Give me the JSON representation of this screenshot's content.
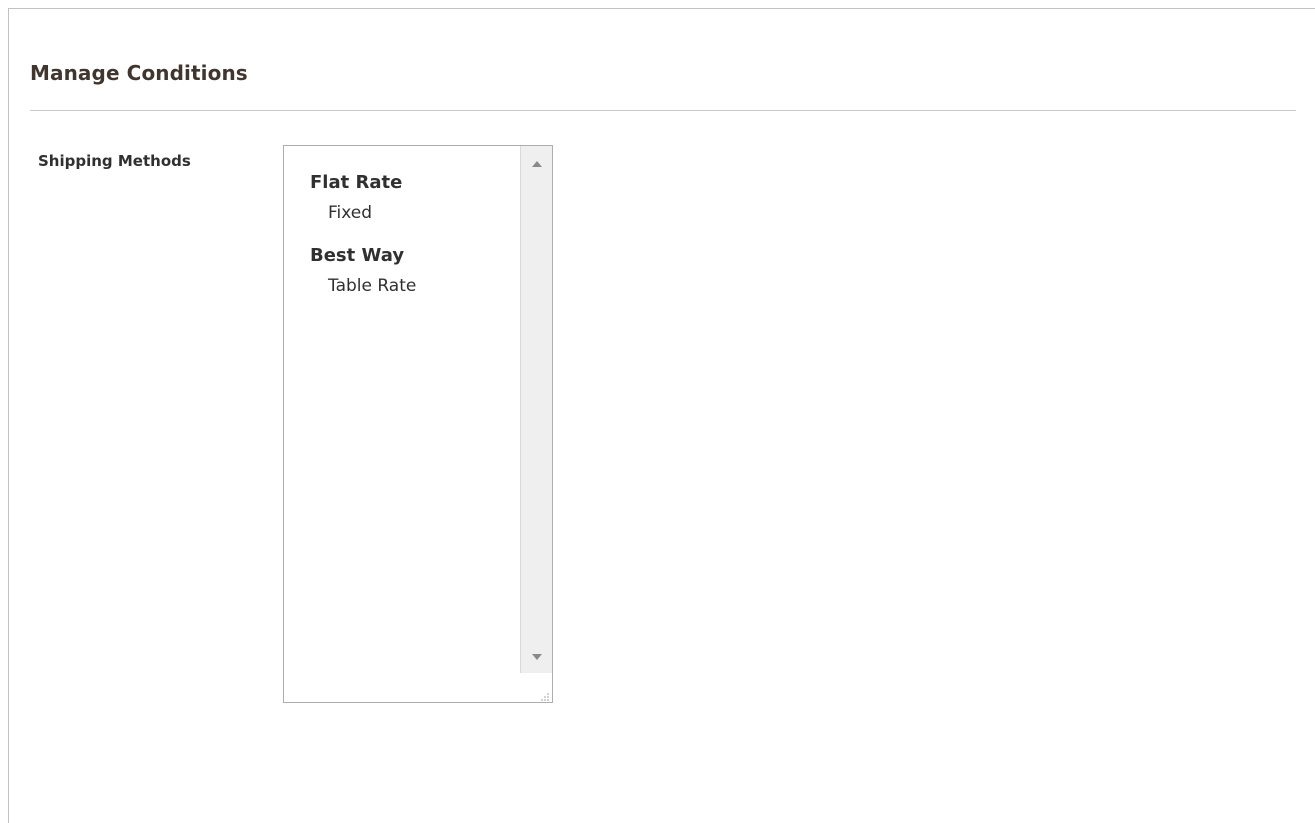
{
  "section": {
    "title": "Manage Conditions"
  },
  "shipping_methods": {
    "label": "Shipping Methods",
    "groups": [
      {
        "label": "Flat Rate",
        "options": [
          "Fixed"
        ]
      },
      {
        "label": "Best Way",
        "options": [
          "Table Rate"
        ]
      }
    ]
  },
  "icons": {
    "scroll_up": "caret-up-icon",
    "scroll_down": "caret-down-icon",
    "resize": "resize-grip-icon"
  },
  "colors": {
    "title": "#41362f",
    "text": "#303030",
    "border": "#adadad",
    "scrollbar": "#efefef"
  }
}
